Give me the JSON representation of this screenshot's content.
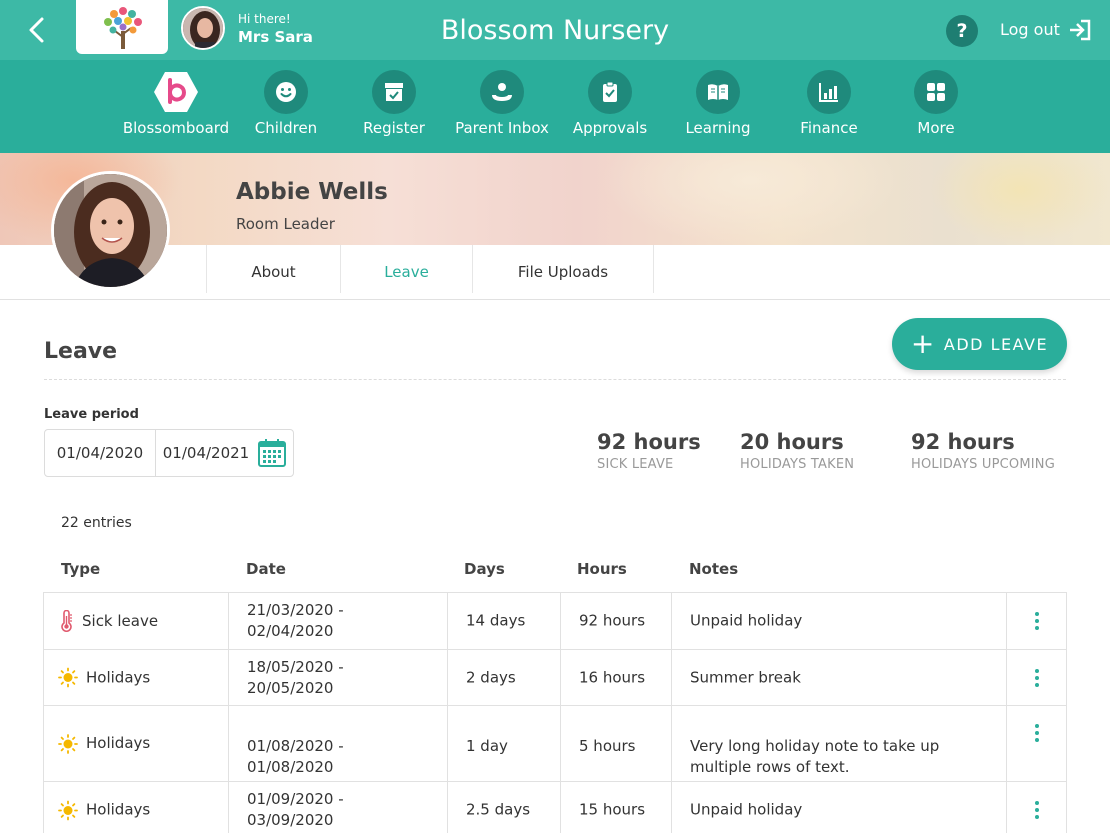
{
  "header": {
    "greeting": "Hi there!",
    "user_name": "Mrs Sara",
    "app_title": "Blossom Nursery",
    "help_label": "?",
    "logout_label": "Log out"
  },
  "nav": {
    "items": [
      {
        "label": "Blossomboard",
        "icon": "blossom-logo-icon"
      },
      {
        "label": "Children",
        "icon": "smiley-icon"
      },
      {
        "label": "Register",
        "icon": "register-check-icon"
      },
      {
        "label": "Parent Inbox",
        "icon": "inbox-icon"
      },
      {
        "label": "Approvals",
        "icon": "clipboard-check-icon"
      },
      {
        "label": "Learning",
        "icon": "book-icon"
      },
      {
        "label": "Finance",
        "icon": "finance-chart-icon"
      },
      {
        "label": "More",
        "icon": "grid-icon"
      }
    ]
  },
  "profile": {
    "name": "Abbie Wells",
    "role": "Room Leader"
  },
  "tabs": [
    {
      "label": "About",
      "active": false
    },
    {
      "label": "Leave",
      "active": true
    },
    {
      "label": "File Uploads",
      "active": false
    }
  ],
  "leave": {
    "title": "Leave",
    "add_button": "ADD LEAVE",
    "period_label": "Leave period",
    "period_from": "01/04/2020",
    "period_to": "01/04/2021",
    "stats": [
      {
        "value": "92 hours",
        "label": "SICK LEAVE"
      },
      {
        "value": "20 hours",
        "label": "HOLIDAYS TAKEN"
      },
      {
        "value": "92 hours",
        "label": "HOLIDAYS UPCOMING"
      }
    ],
    "entries_count": "22 entries",
    "columns": [
      "Type",
      "Date",
      "Days",
      "Hours",
      "Notes"
    ],
    "rows": [
      {
        "type": "Sick leave",
        "icon": "thermometer-icon",
        "date": "21/03/2020 - 02/04/2020",
        "days": "14 days",
        "hours": "92 hours",
        "notes": "Unpaid holiday"
      },
      {
        "type": "Holidays",
        "icon": "sun-icon",
        "date": "18/05/2020 - 20/05/2020",
        "days": "2 days",
        "hours": "16 hours",
        "notes": "Summer break"
      },
      {
        "type": "Holidays",
        "icon": "sun-icon",
        "date": "01/08/2020 - 01/08/2020",
        "days": "1 day",
        "hours": "5 hours",
        "notes": "Very long holiday note to take up multiple rows of text."
      },
      {
        "type": "Holidays",
        "icon": "sun-icon",
        "date": "01/09/2020 - 03/09/2020",
        "days": "2.5 days",
        "hours": "15 hours",
        "notes": "Unpaid holiday"
      }
    ]
  },
  "colors": {
    "topbar": "#3db9a6",
    "navbar": "#2aae9b",
    "nav_circle": "#1f8a7c",
    "accent": "#2aae9b",
    "sick_icon": "#e05a6e",
    "sun_icon": "#f5b800"
  }
}
